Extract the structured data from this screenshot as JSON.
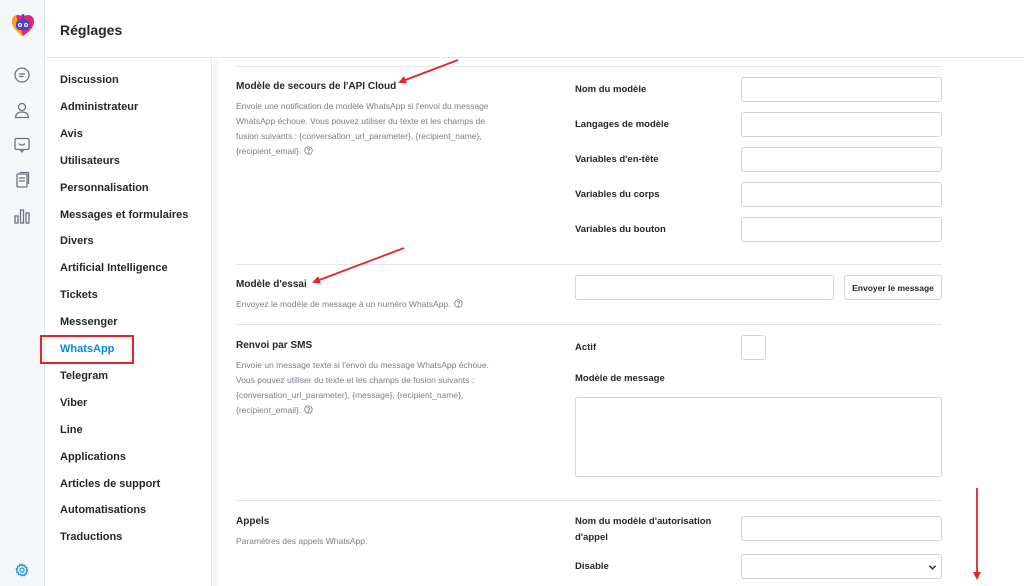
{
  "header": {
    "title": "Réglages"
  },
  "nav": {
    "items": [
      {
        "label": "Discussion"
      },
      {
        "label": "Administrateur"
      },
      {
        "label": "Avis"
      },
      {
        "label": "Utilisateurs"
      },
      {
        "label": "Personnalisation"
      },
      {
        "label": "Messages et formulaires"
      },
      {
        "label": "Divers"
      },
      {
        "label": "Artificial Intelligence"
      },
      {
        "label": "Tickets"
      },
      {
        "label": "Messenger"
      },
      {
        "label": "WhatsApp"
      },
      {
        "label": "Telegram"
      },
      {
        "label": "Viber"
      },
      {
        "label": "Line"
      },
      {
        "label": "Applications"
      },
      {
        "label": "Articles de support"
      },
      {
        "label": "Automatisations"
      },
      {
        "label": "Traductions"
      }
    ],
    "active": "WhatsApp"
  },
  "sections": {
    "fallback": {
      "title": "Modèle de secours de l'API Cloud",
      "desc1": "Envoie une notification de modèle WhatsApp si l'envoi du message",
      "desc2": "WhatsApp échoue. Vous pouvez utiliser du texte et les champs de",
      "desc3": "fusion suivants : {conversation_url_parameter}, {recipient_name},",
      "desc4": "{recipient_email}.",
      "fields": {
        "template_name": "Nom du modèle",
        "template_languages": "Langages de modèle",
        "header_variables": "Variables d'en-tête",
        "body_variables": "Variables du corps",
        "button_variables": "Variables du bouton"
      }
    },
    "test": {
      "title": "Modèle d'essai",
      "desc": "Envoyez le modèle de message à un numéro WhatsApp.",
      "button": "Envoyer le message"
    },
    "sms": {
      "title": "Renvoi par SMS",
      "desc1": "Envoie un message texte si l'envoi du message WhatsApp échoue.",
      "desc2": "Vous pouvez utiliser du texte et les champs de fusion suivants :",
      "desc3": "{conversation_url_parameter}, {message}, {recipient_name},",
      "desc4": "{recipient_email}.",
      "active_label": "Actif",
      "message_template_label": "Modèle de message"
    },
    "calls": {
      "title": "Appels",
      "desc": "Paramètres des appels WhatsApp.",
      "auth_template_label_1": "Nom du modèle d'autorisation",
      "auth_template_label_2": "d'appel",
      "disable_label": "Disable"
    }
  },
  "colors": {
    "accent": "#028be5",
    "annotation_red": "#e5232c"
  },
  "icons": {
    "logo": "bot-logo-icon",
    "chat": "chat-icon",
    "users": "user-icon",
    "tickets": "ticket-icon",
    "articles": "articles-icon",
    "reports": "reports-icon",
    "settings": "gear-icon"
  }
}
